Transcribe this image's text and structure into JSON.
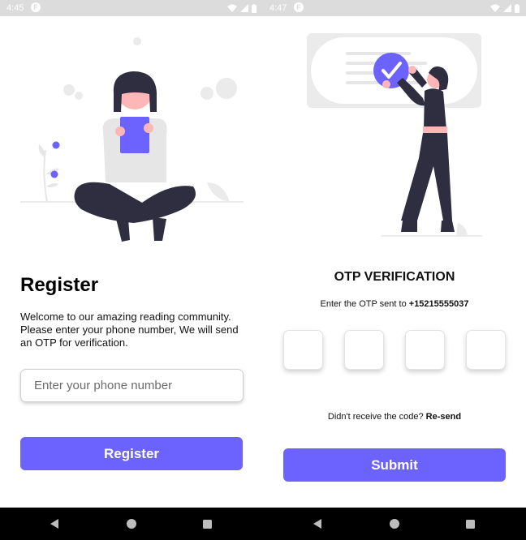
{
  "colors": {
    "accent": "#6c63ff",
    "statusbar": "#dcdcdc",
    "navbar": "#000000",
    "figure_dark": "#2f2e41"
  },
  "left_screen": {
    "status_time": "4:45",
    "status_badge": "F",
    "title": "Register",
    "description": "Welcome to our amazing reading community. Please enter your phone number, We will send an OTP for verification.",
    "phone_placeholder": "Enter your phone number",
    "phone_value": "",
    "register_button": "Register"
  },
  "right_screen": {
    "status_time": "4:47",
    "status_badge": "F",
    "title": "OTP VERIFICATION",
    "subtitle_prefix": "Enter the OTP sent to ",
    "phone_number": "+15215555037",
    "otp_digits": [
      "",
      "",
      "",
      ""
    ],
    "resend_prefix": "Didn't receive the code? ",
    "resend_link": "Re-send",
    "submit_button": "Submit"
  },
  "icons": {
    "status": [
      "wifi-icon",
      "signal-icon",
      "battery-icon"
    ],
    "nav": [
      "back-icon",
      "home-icon",
      "recents-icon"
    ],
    "illustration": [
      "check-circle-icon"
    ]
  }
}
